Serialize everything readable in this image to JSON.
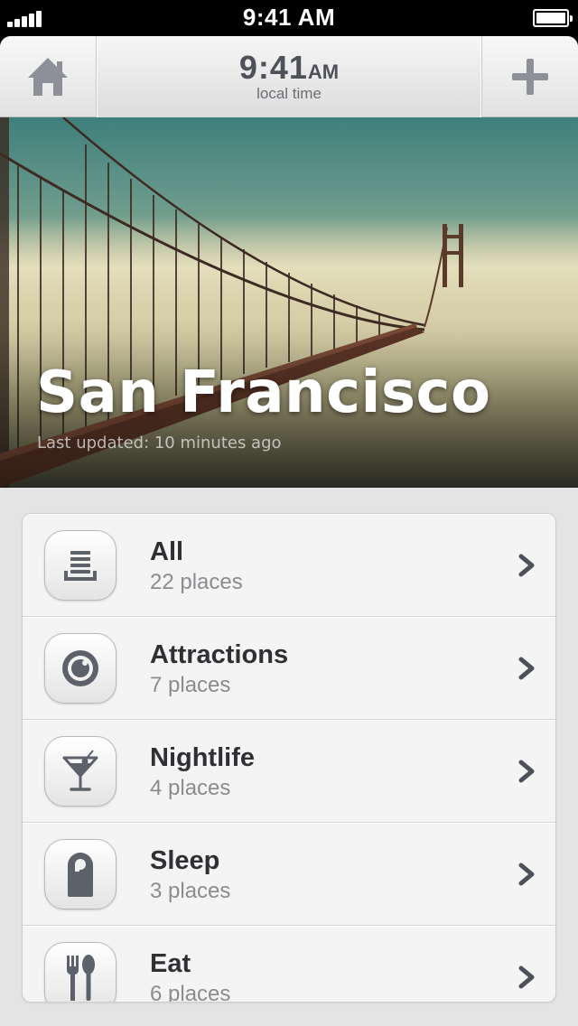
{
  "status_bar": {
    "time": "9:41 AM"
  },
  "header": {
    "time": "9:41",
    "ampm": "AM",
    "subtitle": "local time"
  },
  "hero": {
    "title": "San Francisco",
    "updated": "Last updated: 10 minutes ago"
  },
  "categories": [
    {
      "name": "All",
      "count": "22 places",
      "icon": "list-stack-icon"
    },
    {
      "name": "Attractions",
      "count": "7 places",
      "icon": "camera-lens-icon"
    },
    {
      "name": "Nightlife",
      "count": "4 places",
      "icon": "cocktail-icon"
    },
    {
      "name": "Sleep",
      "count": "3 places",
      "icon": "door-hanger-icon"
    },
    {
      "name": "Eat",
      "count": "6 places",
      "icon": "fork-spoon-icon"
    }
  ],
  "colors": {
    "icon_gray": "#5d6169",
    "text_dark": "#2e3034",
    "text_muted": "#8a8c90"
  }
}
